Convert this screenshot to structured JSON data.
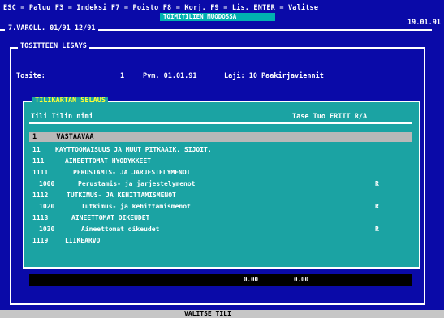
{
  "top_bar": {
    "function_keys": "ESC = Paluu F3 = Indeksi F7 = Poisto F8 = Korj. F9 = Lis. ENTER = Valitse",
    "highlight": "TOIMITILIEN MUODOSSA",
    "date": "19.01.91"
  },
  "outer_window": {
    "title": "7.VAROLL. 01/91 12/91"
  },
  "main_window": {
    "title": "TOSITTEEN LISAYS",
    "label": "Tosite:",
    "number": "1",
    "date_text": "Pvm. 01.01.91",
    "kind_text": "Laji: 10 Paakirjaviennit"
  },
  "account_window": {
    "title": "TILIKARTAN SELAUS",
    "col_left": "Tili  Tilin nimi",
    "col_right": "Tase Tuo ERITT R/A",
    "selected": {
      "account": "1",
      "name": "VASTAAVAA"
    },
    "rows": [
      {
        "account": "11",
        "name": "KAYTTOOMAISUUS JA MUUT PITKAAIK. SIJOIT.",
        "flag": ""
      },
      {
        "account": "111",
        "name": "AINEETTOMAT HYODYKKEET",
        "flag": ""
      },
      {
        "account": "1111",
        "name": "PERUSTAMIS- JA JARJESTELYMENOT",
        "flag": ""
      },
      {
        "account": "1000",
        "name": "Perustamis- ja jarjestelymenot",
        "flag": "R"
      },
      {
        "account": "1112",
        "name": "TUTKIMUS- JA KEHITTAMISMENOT",
        "flag": ""
      },
      {
        "account": "1020",
        "name": "Tutkimus- ja kehittamismenot",
        "flag": "R"
      },
      {
        "account": "1113",
        "name": "AINEETTOMAT OIKEUDET",
        "flag": ""
      },
      {
        "account": "1030",
        "name": "Aineettomat oikeudet",
        "flag": "R"
      },
      {
        "account": "1119",
        "name": "LIIKEARVO",
        "flag": ""
      }
    ],
    "strip_left": "0.00",
    "strip_right": "0.00"
  },
  "status_bar": {
    "text": "VALITSE TILI"
  }
}
